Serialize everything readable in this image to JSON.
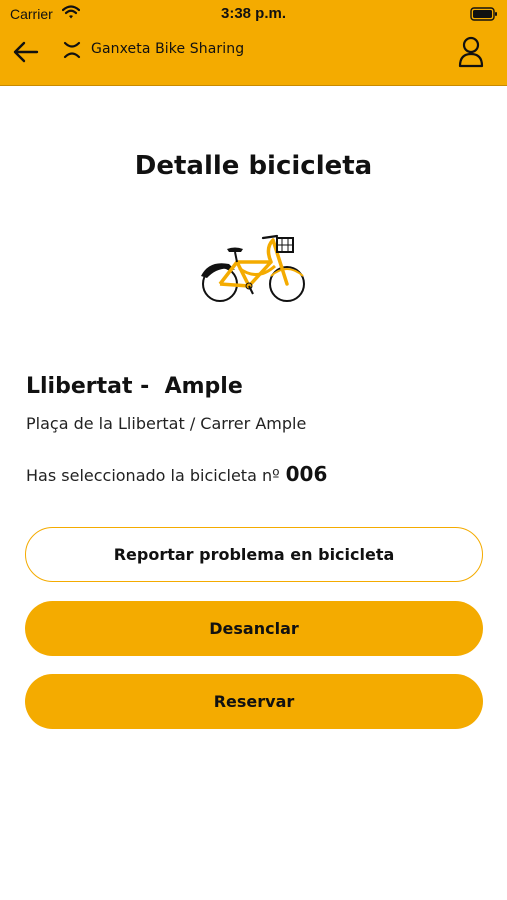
{
  "status_bar": {
    "carrier": "Carrier",
    "time": "3:38 p.m."
  },
  "header": {
    "app_title": "Ganxeta Bike Sharing",
    "back_icon": "arrow-left-icon",
    "brand_icon": "ganxeta-logo-icon",
    "user_icon": "user-profile-icon"
  },
  "page": {
    "title": "Detalle bicicleta"
  },
  "station": {
    "name": "Llibertat -  Ample",
    "address": "Plaça de la Llibertat / Carrer Ample"
  },
  "selection": {
    "label": "Has seleccionado la bicicleta nº",
    "number": "006"
  },
  "actions": {
    "report_label": "Reportar problema en bicicleta",
    "unlock_label": "Desanclar",
    "reserve_label": "Reservar"
  },
  "colors": {
    "accent": "#f4ab00",
    "text": "#111111",
    "background": "#ffffff"
  }
}
